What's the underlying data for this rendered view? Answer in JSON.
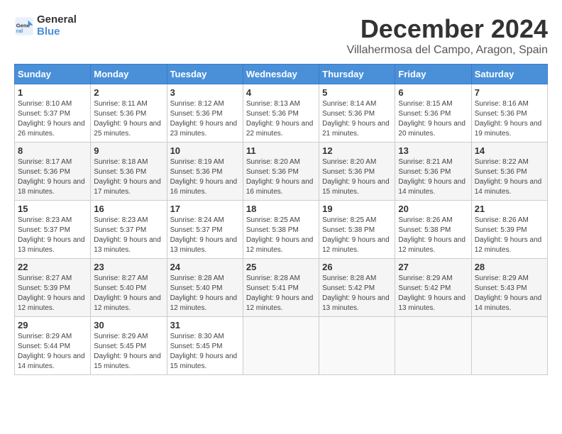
{
  "logo": {
    "line1": "General",
    "line2": "Blue"
  },
  "title": "December 2024",
  "location": "Villahermosa del Campo, Aragon, Spain",
  "days_of_week": [
    "Sunday",
    "Monday",
    "Tuesday",
    "Wednesday",
    "Thursday",
    "Friday",
    "Saturday"
  ],
  "weeks": [
    [
      {
        "num": "1",
        "sunrise": "8:10 AM",
        "sunset": "5:37 PM",
        "daylight": "9 hours and 26 minutes."
      },
      {
        "num": "2",
        "sunrise": "8:11 AM",
        "sunset": "5:36 PM",
        "daylight": "9 hours and 25 minutes."
      },
      {
        "num": "3",
        "sunrise": "8:12 AM",
        "sunset": "5:36 PM",
        "daylight": "9 hours and 23 minutes."
      },
      {
        "num": "4",
        "sunrise": "8:13 AM",
        "sunset": "5:36 PM",
        "daylight": "9 hours and 22 minutes."
      },
      {
        "num": "5",
        "sunrise": "8:14 AM",
        "sunset": "5:36 PM",
        "daylight": "9 hours and 21 minutes."
      },
      {
        "num": "6",
        "sunrise": "8:15 AM",
        "sunset": "5:36 PM",
        "daylight": "9 hours and 20 minutes."
      },
      {
        "num": "7",
        "sunrise": "8:16 AM",
        "sunset": "5:36 PM",
        "daylight": "9 hours and 19 minutes."
      }
    ],
    [
      {
        "num": "8",
        "sunrise": "8:17 AM",
        "sunset": "5:36 PM",
        "daylight": "9 hours and 18 minutes."
      },
      {
        "num": "9",
        "sunrise": "8:18 AM",
        "sunset": "5:36 PM",
        "daylight": "9 hours and 17 minutes."
      },
      {
        "num": "10",
        "sunrise": "8:19 AM",
        "sunset": "5:36 PM",
        "daylight": "9 hours and 16 minutes."
      },
      {
        "num": "11",
        "sunrise": "8:20 AM",
        "sunset": "5:36 PM",
        "daylight": "9 hours and 16 minutes."
      },
      {
        "num": "12",
        "sunrise": "8:20 AM",
        "sunset": "5:36 PM",
        "daylight": "9 hours and 15 minutes."
      },
      {
        "num": "13",
        "sunrise": "8:21 AM",
        "sunset": "5:36 PM",
        "daylight": "9 hours and 14 minutes."
      },
      {
        "num": "14",
        "sunrise": "8:22 AM",
        "sunset": "5:36 PM",
        "daylight": "9 hours and 14 minutes."
      }
    ],
    [
      {
        "num": "15",
        "sunrise": "8:23 AM",
        "sunset": "5:37 PM",
        "daylight": "9 hours and 13 minutes."
      },
      {
        "num": "16",
        "sunrise": "8:23 AM",
        "sunset": "5:37 PM",
        "daylight": "9 hours and 13 minutes."
      },
      {
        "num": "17",
        "sunrise": "8:24 AM",
        "sunset": "5:37 PM",
        "daylight": "9 hours and 13 minutes."
      },
      {
        "num": "18",
        "sunrise": "8:25 AM",
        "sunset": "5:38 PM",
        "daylight": "9 hours and 12 minutes."
      },
      {
        "num": "19",
        "sunrise": "8:25 AM",
        "sunset": "5:38 PM",
        "daylight": "9 hours and 12 minutes."
      },
      {
        "num": "20",
        "sunrise": "8:26 AM",
        "sunset": "5:38 PM",
        "daylight": "9 hours and 12 minutes."
      },
      {
        "num": "21",
        "sunrise": "8:26 AM",
        "sunset": "5:39 PM",
        "daylight": "9 hours and 12 minutes."
      }
    ],
    [
      {
        "num": "22",
        "sunrise": "8:27 AM",
        "sunset": "5:39 PM",
        "daylight": "9 hours and 12 minutes."
      },
      {
        "num": "23",
        "sunrise": "8:27 AM",
        "sunset": "5:40 PM",
        "daylight": "9 hours and 12 minutes."
      },
      {
        "num": "24",
        "sunrise": "8:28 AM",
        "sunset": "5:40 PM",
        "daylight": "9 hours and 12 minutes."
      },
      {
        "num": "25",
        "sunrise": "8:28 AM",
        "sunset": "5:41 PM",
        "daylight": "9 hours and 12 minutes."
      },
      {
        "num": "26",
        "sunrise": "8:28 AM",
        "sunset": "5:42 PM",
        "daylight": "9 hours and 13 minutes."
      },
      {
        "num": "27",
        "sunrise": "8:29 AM",
        "sunset": "5:42 PM",
        "daylight": "9 hours and 13 minutes."
      },
      {
        "num": "28",
        "sunrise": "8:29 AM",
        "sunset": "5:43 PM",
        "daylight": "9 hours and 14 minutes."
      }
    ],
    [
      {
        "num": "29",
        "sunrise": "8:29 AM",
        "sunset": "5:44 PM",
        "daylight": "9 hours and 14 minutes."
      },
      {
        "num": "30",
        "sunrise": "8:29 AM",
        "sunset": "5:45 PM",
        "daylight": "9 hours and 15 minutes."
      },
      {
        "num": "31",
        "sunrise": "8:30 AM",
        "sunset": "5:45 PM",
        "daylight": "9 hours and 15 minutes."
      },
      null,
      null,
      null,
      null
    ]
  ]
}
